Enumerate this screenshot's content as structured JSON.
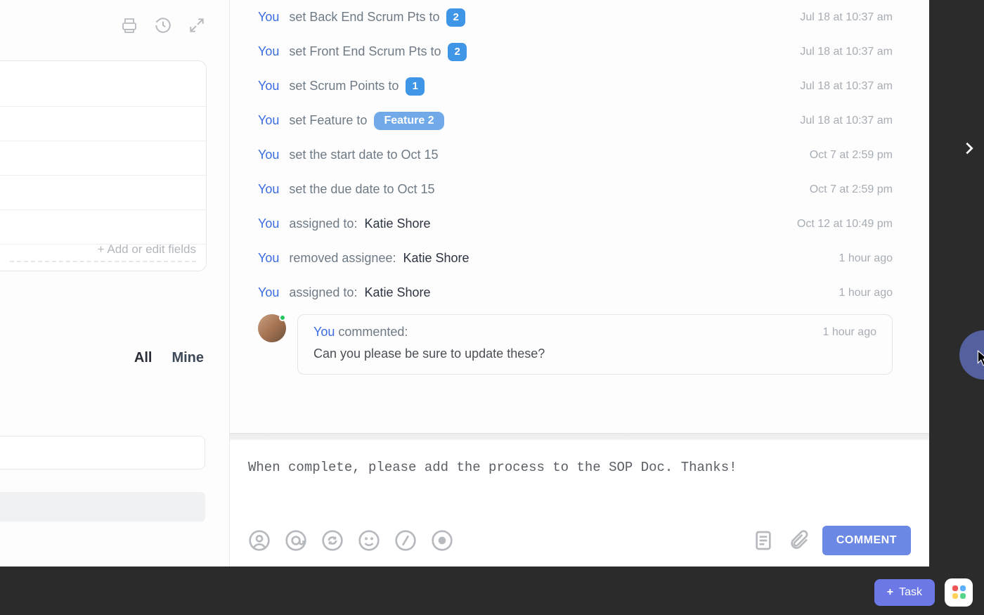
{
  "actor": "You",
  "sidebar": {
    "add_fields_label": "+ Add or edit fields",
    "tabs": {
      "all": "All",
      "mine": "Mine"
    }
  },
  "activity": [
    {
      "kind": "set_badge",
      "text": "set Back End Scrum Pts to",
      "badge": "2",
      "ts": "Jul 18 at 10:37 am"
    },
    {
      "kind": "set_badge",
      "text": "set Front End Scrum Pts to",
      "badge": "2",
      "ts": "Jul 18 at 10:37 am"
    },
    {
      "kind": "set_badge",
      "text": "set Scrum Points to",
      "badge": "1",
      "ts": "Jul 18 at 10:37 am"
    },
    {
      "kind": "set_pill",
      "text": "set Feature to",
      "pill": "Feature 2",
      "ts": "Jul 18 at 10:37 am"
    },
    {
      "kind": "plain",
      "text": "set the start date to Oct 15",
      "ts": "Oct 7 at 2:59 pm"
    },
    {
      "kind": "plain",
      "text": "set the due date to Oct 15",
      "ts": "Oct 7 at 2:59 pm"
    },
    {
      "kind": "assignee",
      "text": "assigned to:",
      "name": "Katie Shore",
      "ts": "Oct 12 at 10:49 pm"
    },
    {
      "kind": "assignee",
      "text": "removed assignee:",
      "name": "Katie Shore",
      "ts": "1 hour ago"
    },
    {
      "kind": "assignee",
      "text": "assigned to:",
      "name": "Katie Shore",
      "ts": "1 hour ago"
    }
  ],
  "comment": {
    "label": "commented:",
    "ts": "1 hour ago",
    "body": "Can you please be sure to update these?"
  },
  "composer": {
    "value": "When complete, please add the process to the SOP Doc. Thanks!",
    "submit": "COMMENT"
  },
  "bottom": {
    "task_label": "Task"
  }
}
